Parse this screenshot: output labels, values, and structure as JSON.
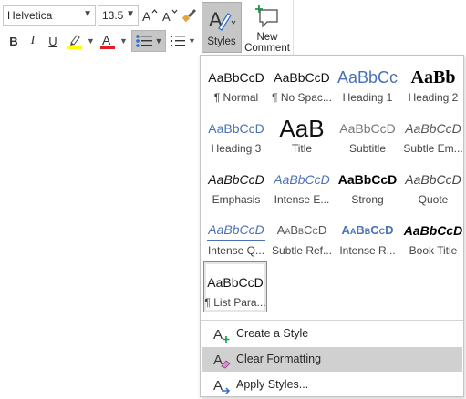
{
  "toolbar": {
    "font_name": "Helvetica",
    "font_size": "13.5",
    "bold": "B",
    "italic": "I",
    "underline": "U",
    "styles_label": "Styles",
    "new_comment_line1": "New",
    "new_comment_line2": "Comment",
    "highlight_color": "#ffff00",
    "font_color": "#e02020"
  },
  "gallery": {
    "styles": [
      {
        "sample": "AaBbCcD",
        "name": "¶ Normal"
      },
      {
        "sample": "AaBbCcD",
        "name": "¶ No Spac..."
      },
      {
        "sample": "AaBbCc",
        "name": "Heading 1"
      },
      {
        "sample": "AaBb",
        "name": "Heading 2"
      },
      {
        "sample": "AaBbCcD",
        "name": "Heading 3"
      },
      {
        "sample": "AaB",
        "name": "Title"
      },
      {
        "sample": "AaBbCcD",
        "name": "Subtitle"
      },
      {
        "sample": "AaBbCcD",
        "name": "Subtle Em..."
      },
      {
        "sample": "AaBbCcD",
        "name": "Emphasis"
      },
      {
        "sample": "AaBbCcD",
        "name": "Intense E..."
      },
      {
        "sample": "AaBbCcD",
        "name": "Strong"
      },
      {
        "sample": "AaBbCcD",
        "name": "Quote"
      },
      {
        "sample": "AaBbCcD",
        "name": "Intense Q..."
      },
      {
        "sample": "AaBbCcD",
        "name": "Subtle Ref..."
      },
      {
        "sample": "AaBbCcD",
        "name": "Intense R..."
      },
      {
        "sample": "AaBbCcD",
        "name": "Book Title"
      },
      {
        "sample": "AaBbCcD",
        "name": "¶ List Para..."
      }
    ],
    "commands": {
      "create_style": "Create a Style",
      "clear_formatting": "Clear Formatting",
      "apply_styles": "Apply Styles..."
    }
  }
}
